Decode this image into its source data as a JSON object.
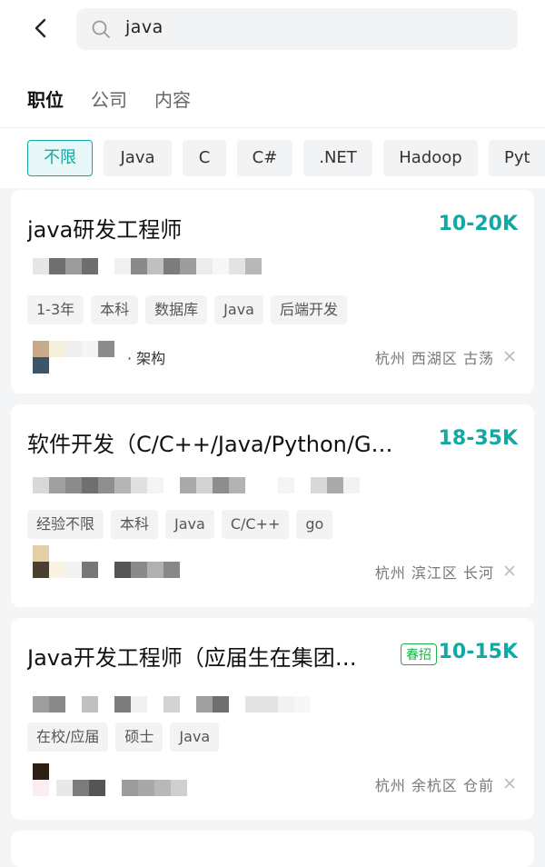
{
  "search": {
    "query": "java"
  },
  "tabs": [
    {
      "label": "职位",
      "active": true
    },
    {
      "label": "公司",
      "active": false
    },
    {
      "label": "内容",
      "active": false
    }
  ],
  "filters": [
    {
      "label": "不限",
      "active": true
    },
    {
      "label": "Java"
    },
    {
      "label": "C"
    },
    {
      "label": "C#"
    },
    {
      "label": ".NET"
    },
    {
      "label": "Hadoop"
    },
    {
      "label": "Pyt"
    }
  ],
  "jobs": [
    {
      "title": "java研发工程师",
      "salary": "10-20K",
      "tags": [
        "1-3年",
        "本科",
        "数据库",
        "Java",
        "后端开发"
      ],
      "company_suffix": "· 架构",
      "location": "杭州  西湖区  古荡"
    },
    {
      "title": "软件开发（C/C++/Java/Python/G…",
      "salary": "18-35K",
      "tags": [
        "经验不限",
        "本科",
        "Java",
        "C/C++",
        "go"
      ],
      "location": "杭州  滨江区  长河"
    },
    {
      "title": "Java开发工程师（应届生在集团…",
      "badge": "春招",
      "salary": "10-15K",
      "tags": [
        "在校/应届",
        "硕士",
        "Java"
      ],
      "location": "杭州  余杭区  仓前"
    }
  ],
  "colors": {
    "accent": "#12a9a4",
    "badge": "#21b14a"
  }
}
